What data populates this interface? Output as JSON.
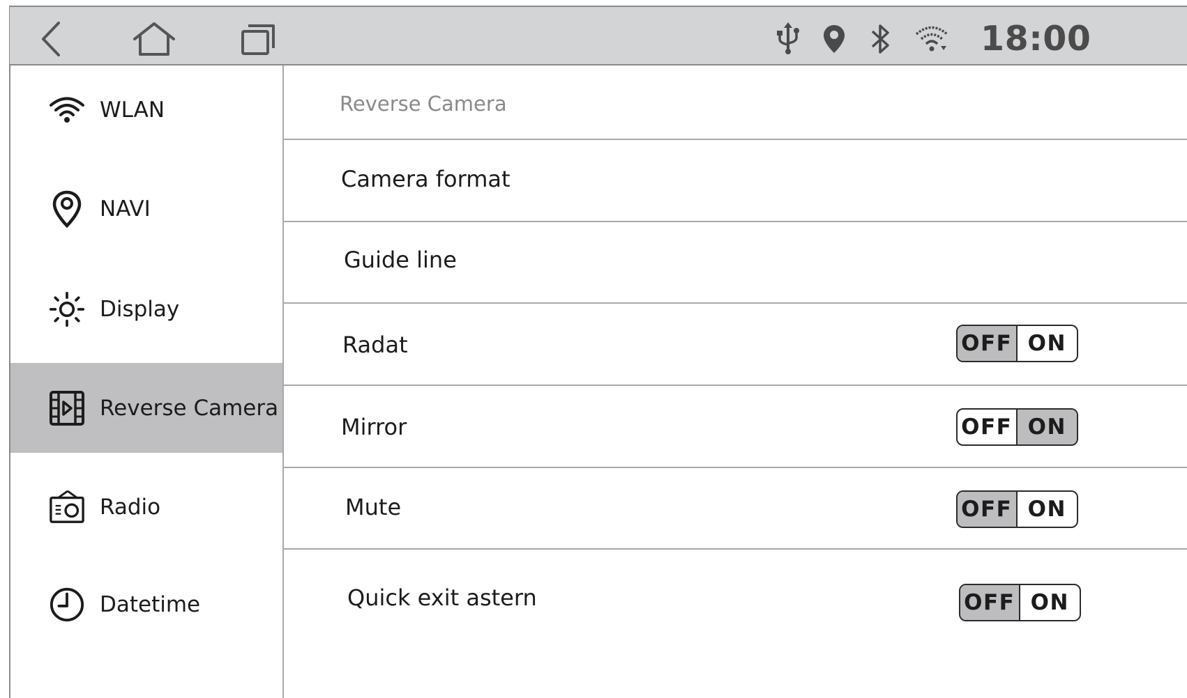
{
  "status_bar": {
    "nav_icons": [
      "back-icon",
      "home-icon",
      "recents-icon"
    ],
    "status_icons": [
      "usb-icon",
      "location-pin-icon",
      "bluetooth-icon",
      "wifi-icon"
    ],
    "time": "18:00"
  },
  "sidebar": {
    "items": [
      {
        "label": "WLAN",
        "icon": "wifi-icon",
        "active": false
      },
      {
        "label": "NAVI",
        "icon": "map-pin-icon",
        "active": false
      },
      {
        "label": "Display",
        "icon": "brightness-icon",
        "active": false
      },
      {
        "label": "Reverse Camera",
        "icon": "camera-film-icon",
        "active": true
      },
      {
        "label": "Radio",
        "icon": "radio-icon",
        "active": false
      },
      {
        "label": "Datetime",
        "icon": "clock-icon",
        "active": false
      }
    ]
  },
  "main": {
    "title": "Reverse Camera",
    "rows": [
      {
        "label": "Camera format"
      },
      {
        "label": "Guide line"
      },
      {
        "label": "Radat",
        "toggle": {
          "off": "OFF",
          "on": "ON",
          "value": "OFF"
        }
      },
      {
        "label": "Mirror",
        "toggle": {
          "off": "OFF",
          "on": "ON",
          "value": "ON"
        }
      },
      {
        "label": "Mute",
        "toggle": {
          "off": "OFF",
          "on": "ON",
          "value": "OFF"
        }
      },
      {
        "label": "Quick exit astern",
        "toggle": {
          "off": "OFF",
          "on": "ON",
          "value": "OFF"
        }
      }
    ]
  },
  "colors": {
    "status_bar_bg": "#d3d4d6",
    "active_item_bg": "#bfbfc1",
    "toggle_selected_bg": "#bdbdbf",
    "title_gray": "#8a8a8a"
  }
}
